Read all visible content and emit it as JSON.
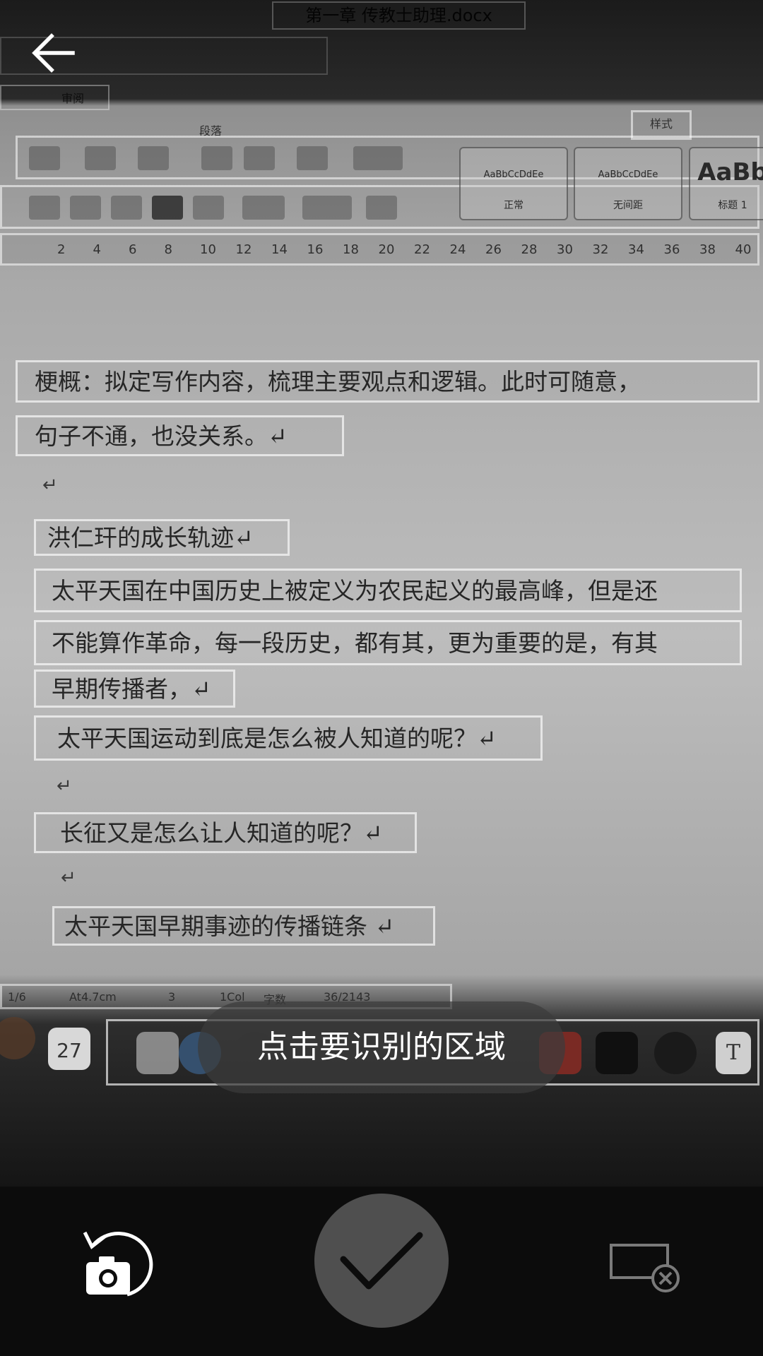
{
  "document": {
    "file_title": "第一章 传教士助理.docx",
    "tab_label": "审阅",
    "section_label": "段落",
    "style_label": "样式",
    "style_gallery": [
      {
        "sample": "AaBbCcDdEe",
        "name": "正常"
      },
      {
        "sample": "AaBbCcDdEe",
        "name": "无间距"
      },
      {
        "sample": "AaBb",
        "name": "标题 1"
      }
    ],
    "ruler_ticks": [
      "2",
      "4",
      "6",
      "8",
      "10",
      "12",
      "14",
      "16",
      "18",
      "20",
      "22",
      "24",
      "26",
      "28",
      "30",
      "32",
      "34",
      "36",
      "38",
      "40"
    ],
    "text_regions": [
      "梗概：拟定写作内容，梳理主要观点和逻辑。此时可随意，",
      "句子不通，也没关系。↵",
      "洪仁玕的成长轨迹↵",
      "太平天国在中国历史上被定义为农民起义的最高峰，但是还",
      "不能算作革命，每一段历史，都有其，更为重要的是，有其",
      "早期传播者，↵",
      "太平天国运动到底是怎么被人知道的呢？↵",
      "长征又是怎么让人知道的呢？↵",
      "太平天国早期事迹的传播链条 ↵"
    ],
    "paragraph_marks": [
      "↵",
      "↵",
      "↵"
    ],
    "status_bar": [
      "1/6",
      "At4.7cm",
      "3",
      "1Col",
      "字数",
      "36/2143"
    ],
    "dock_calendar_day": "27",
    "dock_text_icon": "T"
  },
  "toast": {
    "text": "点击要识别的区域"
  },
  "icons": {
    "back": "arrow-left-icon",
    "retake": "camera-rotate-icon",
    "confirm": "checkmark-icon",
    "select_all": "select-region-icon"
  }
}
